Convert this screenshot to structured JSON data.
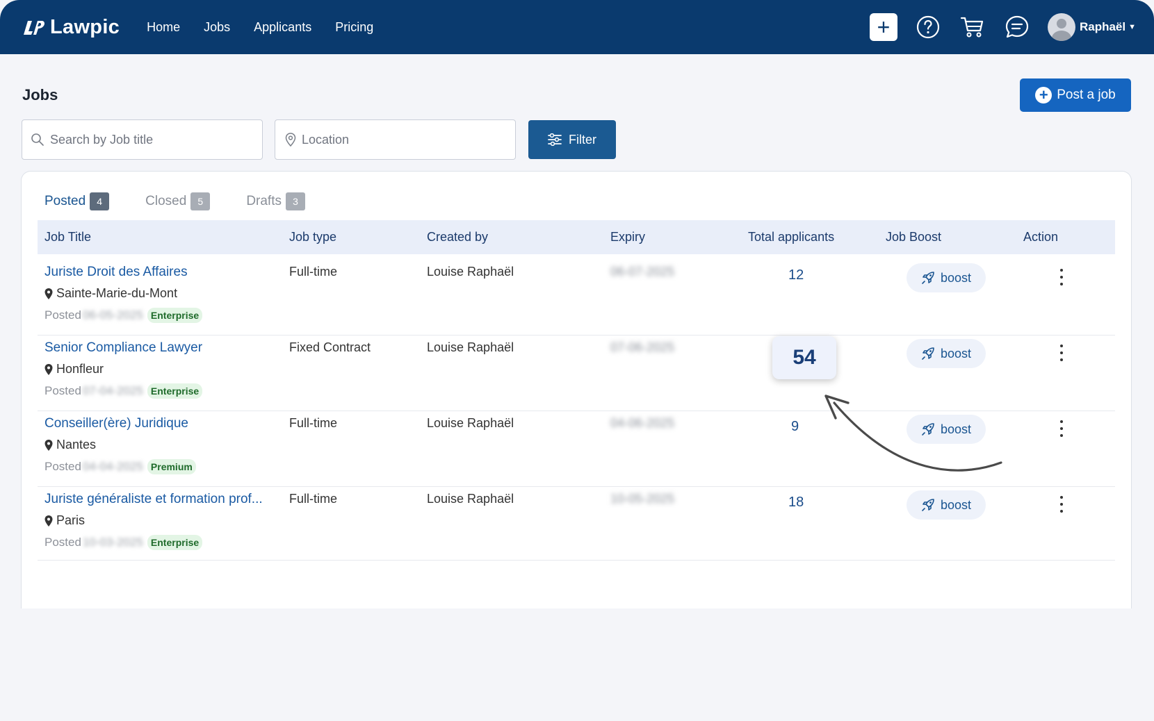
{
  "app": {
    "name": "Lawpic"
  },
  "nav": {
    "items": [
      "Home",
      "Jobs",
      "Applicants",
      "Pricing"
    ]
  },
  "header": {
    "plus_label": "+",
    "user_name": "Raphaël",
    "icons": [
      "help-icon",
      "cart-icon",
      "chat-icon"
    ]
  },
  "page": {
    "title": "Jobs",
    "post_job_label": "Post a job"
  },
  "search": {
    "job_placeholder": "Search by Job title",
    "location_placeholder": "Location",
    "filter_label": "Filter"
  },
  "tabs": [
    {
      "label": "Posted",
      "count": "4",
      "active": true
    },
    {
      "label": "Closed",
      "count": "5",
      "active": false
    },
    {
      "label": "Drafts",
      "count": "3",
      "active": false
    }
  ],
  "table": {
    "columns": [
      "Job Title",
      "Job type",
      "Created by",
      "Expiry",
      "Total applicants",
      "Job Boost",
      "Action"
    ],
    "rows": [
      {
        "title": "Juriste Droit des Affaires",
        "location": "Sainte-Marie-du-Mont",
        "posted_label": "Posted",
        "posted_date": "06-05-2025",
        "plan": "Enterprise",
        "type": "Full-time",
        "created_by": "Louise Raphaël",
        "expiry": "06-07-2025",
        "applicants": "12",
        "boost": "boost"
      },
      {
        "title": "Senior Compliance Lawyer",
        "location": "Honfleur",
        "posted_label": "Posted",
        "posted_date": "07-04-2025",
        "plan": "Enterprise",
        "type": "Fixed Contract",
        "created_by": "Louise Raphaël",
        "expiry": "07-06-2025",
        "applicants": "54",
        "boost": "boost"
      },
      {
        "title": "Conseiller(ère) Juridique",
        "location": "Nantes",
        "posted_label": "Posted",
        "posted_date": "04-04-2025",
        "plan": "Premium",
        "type": "Full-time",
        "created_by": "Louise Raphaël",
        "expiry": "04-06-2025",
        "applicants": "9",
        "boost": "boost"
      },
      {
        "title": "Juriste généraliste et formation prof...",
        "location": "Paris",
        "posted_label": "Posted",
        "posted_date": "10-03-2025",
        "plan": "Enterprise",
        "type": "Full-time",
        "created_by": "Louise Raphaël",
        "expiry": "10-05-2025",
        "applicants": "18",
        "boost": "boost"
      }
    ]
  },
  "colors": {
    "nav_bg": "#0a3a6e",
    "primary": "#1565c0",
    "link": "#1a5aa3",
    "badge_bg": "#e3f5e5"
  }
}
